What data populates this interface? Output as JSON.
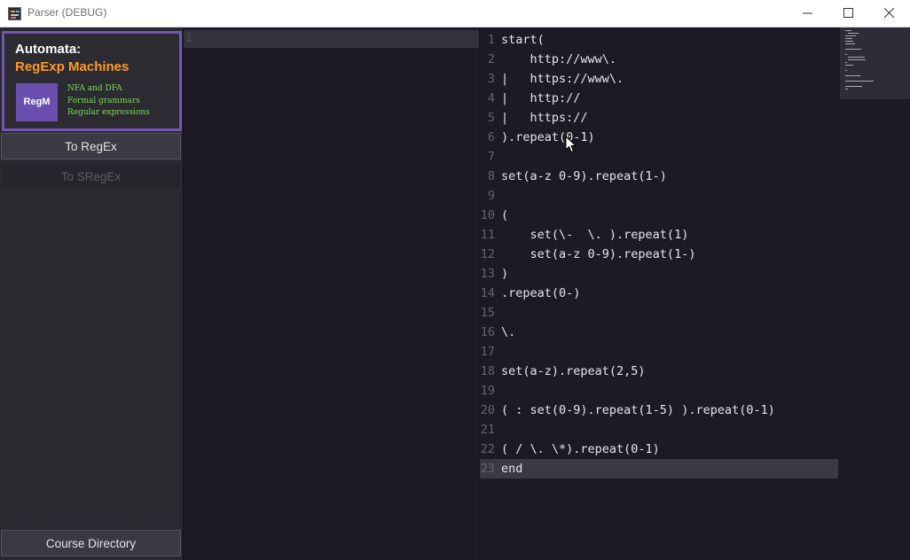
{
  "window": {
    "title": "Parser (DEBUG)",
    "controls": [
      "minimize",
      "maximize",
      "close"
    ]
  },
  "banner": {
    "title_line1": "Automata:",
    "title_line2": "RegExp Machines",
    "logo_text": "RegM",
    "items": [
      "NFA and DFA",
      "Formal grammars",
      "Regular expressions"
    ]
  },
  "buttons": {
    "to_regex": "To RegEx",
    "to_sregex": "To SRegEx",
    "course_directory": "Course Directory"
  },
  "input_editor": {
    "line_numbers": [
      "1"
    ]
  },
  "code_editor": {
    "active_line": 23,
    "lines": [
      {
        "num": "1",
        "text": "start("
      },
      {
        "num": "2",
        "text": "    http://www\\."
      },
      {
        "num": "3",
        "text": "|   https://www\\."
      },
      {
        "num": "4",
        "text": "|   http://"
      },
      {
        "num": "5",
        "text": "|   https://"
      },
      {
        "num": "6",
        "text": ").repeat(0-1)"
      },
      {
        "num": "7",
        "text": ""
      },
      {
        "num": "8",
        "text": "set(a-z 0-9).repeat(1-)"
      },
      {
        "num": "9",
        "text": ""
      },
      {
        "num": "10",
        "text": "("
      },
      {
        "num": "11",
        "text": "    set(\\-  \\. ).repeat(1)"
      },
      {
        "num": "12",
        "text": "    set(a-z 0-9).repeat(1-)"
      },
      {
        "num": "13",
        "text": ")"
      },
      {
        "num": "14",
        "text": ".repeat(0-)"
      },
      {
        "num": "15",
        "text": ""
      },
      {
        "num": "16",
        "text": "\\."
      },
      {
        "num": "17",
        "text": ""
      },
      {
        "num": "18",
        "text": "set(a-z).repeat(2,5)"
      },
      {
        "num": "19",
        "text": ""
      },
      {
        "num": "20",
        "text": "( : set(0-9).repeat(1-5) ).repeat(0-1)"
      },
      {
        "num": "21",
        "text": ""
      },
      {
        "num": "22",
        "text": "( / \\. \\*).repeat(0-1)"
      },
      {
        "num": "23",
        "text": "end"
      }
    ]
  },
  "colors": {
    "accent_purple": "#7158b2",
    "banner_orange": "#ff9a26",
    "banner_green": "#7bd957",
    "editor_bg": "#1d1a26",
    "panel_bg": "#292930"
  },
  "icons": [
    "app-icon",
    "minimize-icon",
    "maximize-icon",
    "close-icon",
    "mouse-cursor-icon"
  ]
}
